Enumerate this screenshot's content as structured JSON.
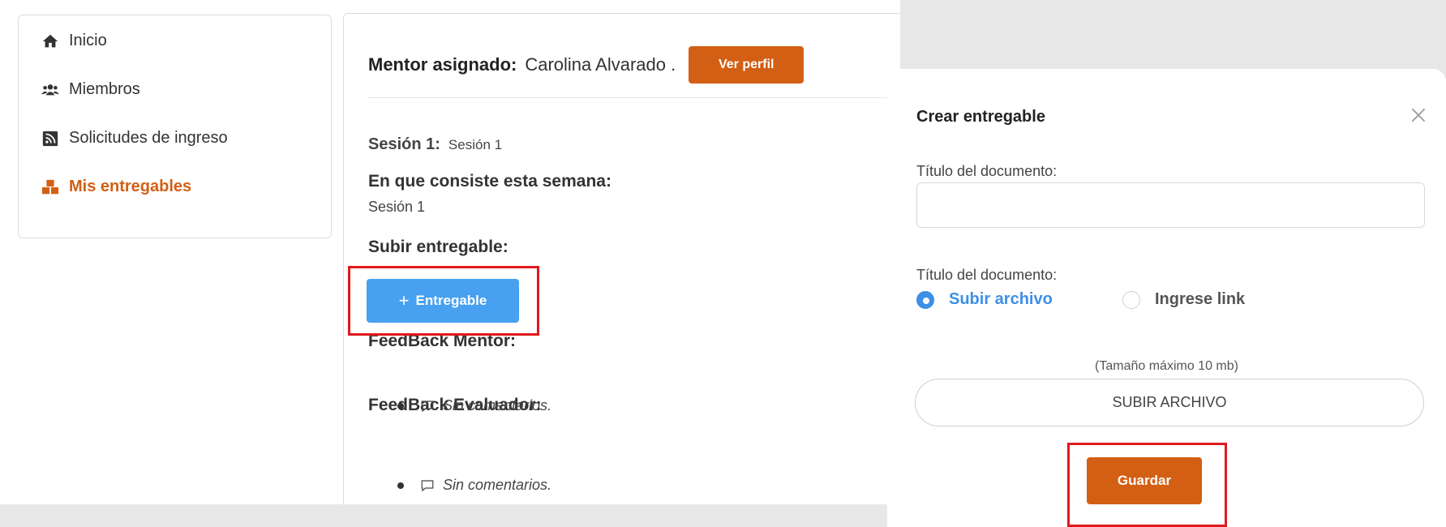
{
  "sidebar": {
    "items": [
      {
        "label": "Inicio",
        "icon": "home-icon"
      },
      {
        "label": "Miembros",
        "icon": "users-icon"
      },
      {
        "label": "Solicitudes de ingreso",
        "icon": "rss-icon"
      },
      {
        "label": "Mis entregables",
        "icon": "cubes-icon",
        "active": true
      }
    ]
  },
  "main": {
    "mentor_label": "Mentor asignado:",
    "mentor_name": "Carolina Alvarado .",
    "profile_button": "Ver perfil",
    "session_label": "Sesión 1:",
    "session_value": "Sesión 1",
    "week_heading": "En que consiste esta semana:",
    "week_text": "Sesión 1",
    "upload_heading": "Subir entregable:",
    "deliverable_button": "Entregable",
    "mentor_feedback_heading": "FeedBack Mentor:",
    "mentor_feedback_text": "Sin comentarios.",
    "evaluator_feedback_heading": "FeedBack Evaluador:",
    "evaluator_feedback_text": "Sin comentarios."
  },
  "modal": {
    "title": "Crear entregable",
    "doc_title_label": "Título del documento:",
    "doc_title_value": "",
    "doc_type_label": "Título del documento:",
    "options": [
      {
        "label": "Subir archivo",
        "selected": true
      },
      {
        "label": "Ingrese link",
        "selected": false
      }
    ],
    "max_size": "(Tamaño máximo 10 mb)",
    "upload_button": "SUBIR ARCHIVO",
    "save_button": "Guardar"
  },
  "colors": {
    "accent_orange": "#d35f14",
    "primary_blue": "#47a1f0",
    "radio_blue": "#3d8fe6",
    "highlight_red": "#e0191d"
  }
}
